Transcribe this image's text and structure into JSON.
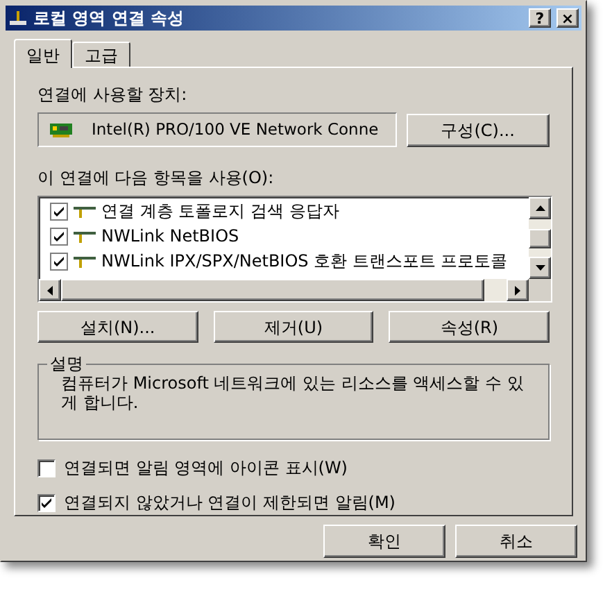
{
  "window": {
    "title": "로컬 영역 연결 속성",
    "buttons": [
      "?",
      "×"
    ]
  },
  "tabs": [
    {
      "label": "일반",
      "selected": true
    },
    {
      "label": "고급",
      "selected": false
    }
  ],
  "device": {
    "label": "연결에 사용할 장치:",
    "value": "Intel(R) PRO/100 VE Network Conne",
    "button": "구성(C)..."
  },
  "items": {
    "label": "이 연결에 다음 항목을 사용(O):",
    "rows": [
      {
        "text": "연결 계층 토폴로지 검색 응답자",
        "checked": true
      },
      {
        "text": "NWLink NetBIOS",
        "checked": true
      },
      {
        "text": "NWLink IPX/SPX/NetBIOS 호환 트랜스포트 프로토콜",
        "checked": true
      }
    ],
    "buttons": [
      "설치(N)...",
      "제거(U)",
      "속성(R)"
    ]
  },
  "description": {
    "title": "설명",
    "text": "컴퓨터가 Microsoft 네트워크에 있는 리소스를 액세스할 수 있게 합니다."
  },
  "options": [
    {
      "label": "연결되면 알림 영역에 아이콘 표시(W)",
      "checked": false
    },
    {
      "label": "연결되지 않았거나 연결이 제한되면 알림(M)",
      "checked": true
    }
  ],
  "footer": {
    "buttons": [
      "확인",
      "취소"
    ]
  }
}
